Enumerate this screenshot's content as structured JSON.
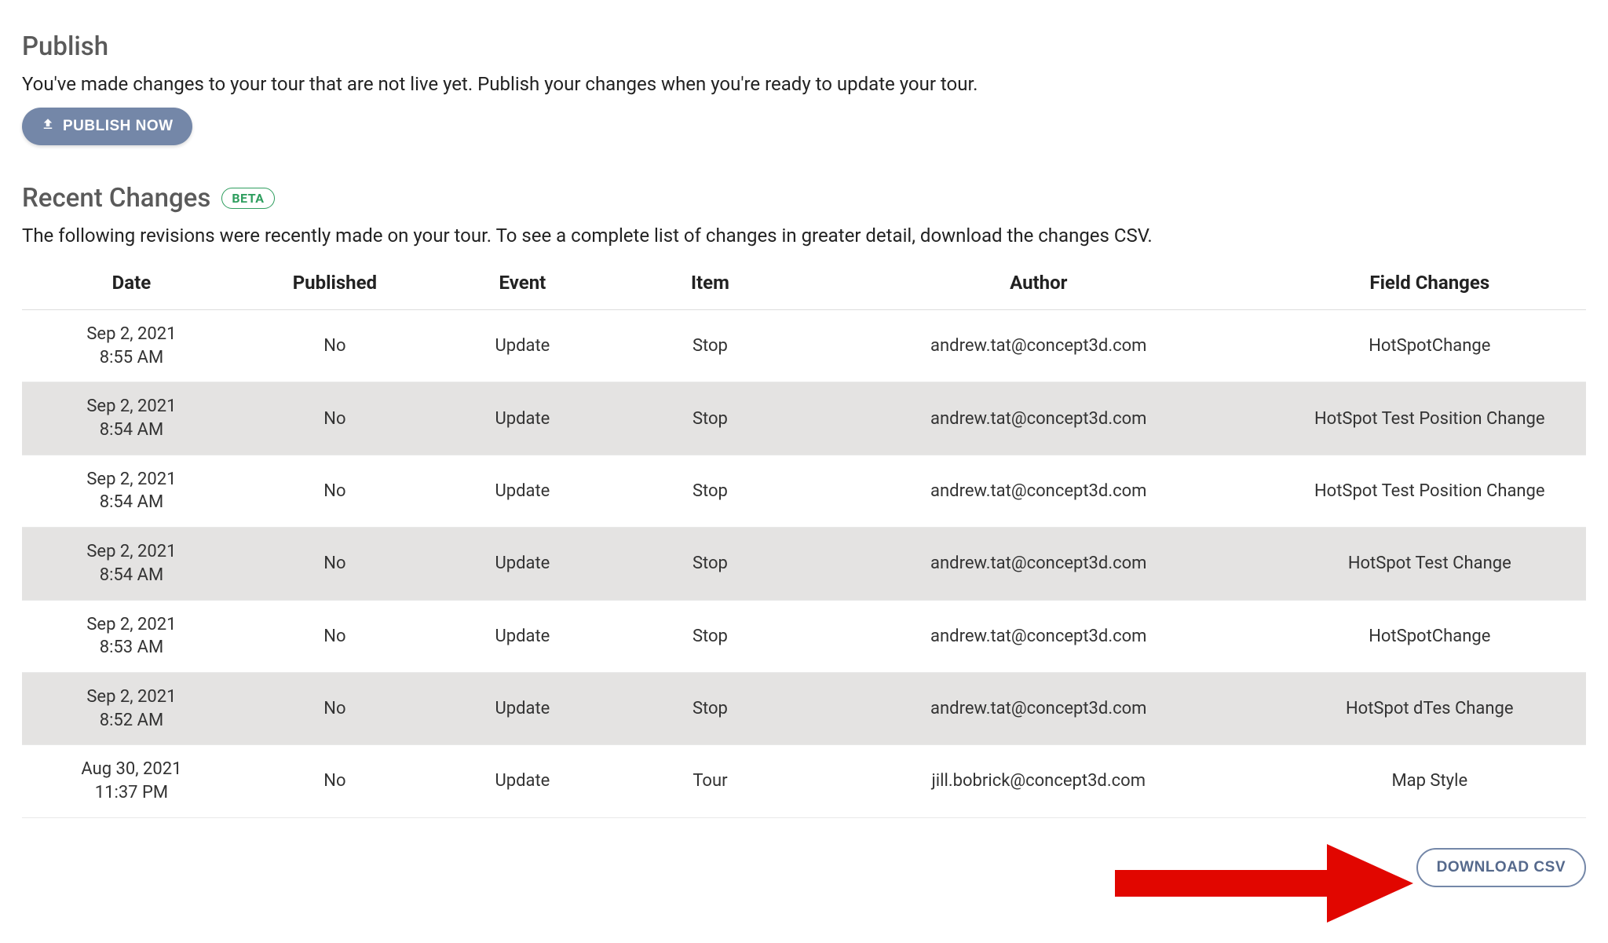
{
  "publish": {
    "title": "Publish",
    "desc": "You've made changes to your tour that are not live yet. Publish your changes when you're ready to update your tour.",
    "button": "PUBLISH NOW"
  },
  "recent": {
    "title": "Recent Changes",
    "badge": "BETA",
    "desc": "The following revisions were recently made on your tour. To see a complete list of changes in greater detail, download the changes CSV.",
    "columns": [
      "Date",
      "Published",
      "Event",
      "Item",
      "Author",
      "Field Changes"
    ],
    "rows": [
      {
        "date": "Sep 2, 2021",
        "time": "8:55 AM",
        "published": "No",
        "event": "Update",
        "item": "Stop",
        "author": "andrew.tat@concept3d.com",
        "field": "HotSpotChange"
      },
      {
        "date": "Sep 2, 2021",
        "time": "8:54 AM",
        "published": "No",
        "event": "Update",
        "item": "Stop",
        "author": "andrew.tat@concept3d.com",
        "field": "HotSpot Test Position Change"
      },
      {
        "date": "Sep 2, 2021",
        "time": "8:54 AM",
        "published": "No",
        "event": "Update",
        "item": "Stop",
        "author": "andrew.tat@concept3d.com",
        "field": "HotSpot Test Position Change"
      },
      {
        "date": "Sep 2, 2021",
        "time": "8:54 AM",
        "published": "No",
        "event": "Update",
        "item": "Stop",
        "author": "andrew.tat@concept3d.com",
        "field": "HotSpot Test Change"
      },
      {
        "date": "Sep 2, 2021",
        "time": "8:53 AM",
        "published": "No",
        "event": "Update",
        "item": "Stop",
        "author": "andrew.tat@concept3d.com",
        "field": "HotSpotChange"
      },
      {
        "date": "Sep 2, 2021",
        "time": "8:52 AM",
        "published": "No",
        "event": "Update",
        "item": "Stop",
        "author": "andrew.tat@concept3d.com",
        "field": "HotSpot dTes Change"
      },
      {
        "date": "Aug 30, 2021",
        "time": "11:37 PM",
        "published": "No",
        "event": "Update",
        "item": "Tour",
        "author": "jill.bobrick@concept3d.com",
        "field": "Map Style"
      }
    ],
    "download": "DOWNLOAD CSV"
  }
}
